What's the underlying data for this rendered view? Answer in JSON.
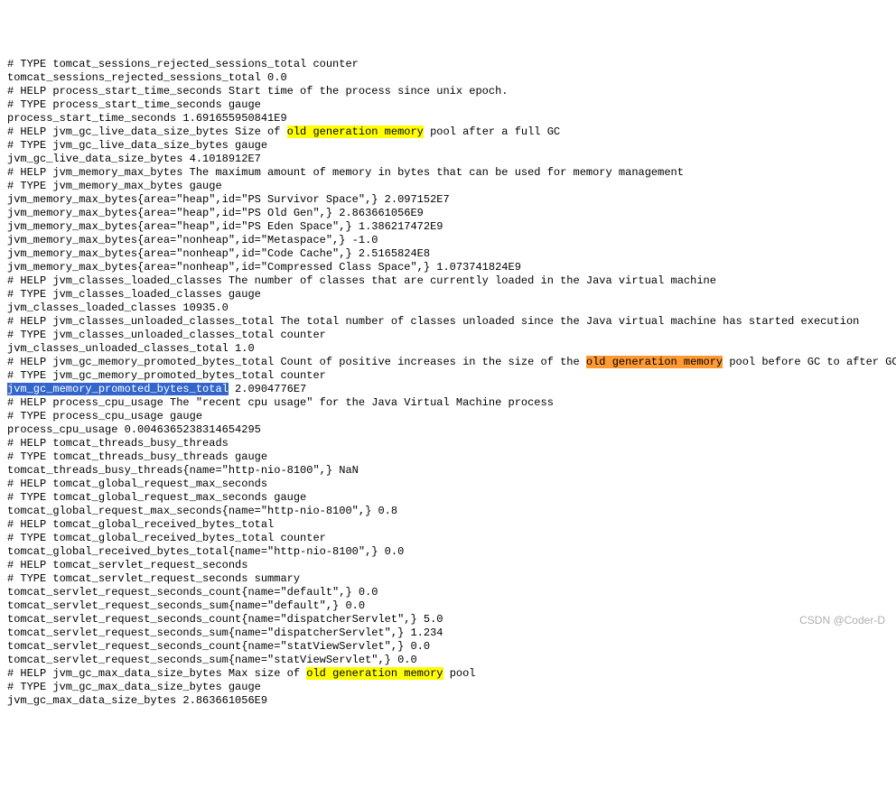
{
  "watermark": "CSDN @Coder-D",
  "lines": [
    {
      "parts": [
        {
          "t": "# TYPE tomcat_sessions_rejected_sessions_total counter"
        }
      ]
    },
    {
      "parts": [
        {
          "t": "tomcat_sessions_rejected_sessions_total 0.0"
        }
      ]
    },
    {
      "parts": [
        {
          "t": "# HELP process_start_time_seconds Start time of the process since unix epoch."
        }
      ]
    },
    {
      "parts": [
        {
          "t": "# TYPE process_start_time_seconds gauge"
        }
      ]
    },
    {
      "parts": [
        {
          "t": "process_start_time_seconds 1.691655950841E9"
        }
      ]
    },
    {
      "parts": [
        {
          "t": "# HELP jvm_gc_live_data_size_bytes Size of "
        },
        {
          "t": "old generation memory",
          "hl": "yellow"
        },
        {
          "t": " pool after a full GC"
        }
      ]
    },
    {
      "parts": [
        {
          "t": "# TYPE jvm_gc_live_data_size_bytes gauge"
        }
      ]
    },
    {
      "parts": [
        {
          "t": "jvm_gc_live_data_size_bytes 4.1018912E7"
        }
      ]
    },
    {
      "parts": [
        {
          "t": "# HELP jvm_memory_max_bytes The maximum amount of memory in bytes that can be used for memory management"
        }
      ]
    },
    {
      "parts": [
        {
          "t": "# TYPE jvm_memory_max_bytes gauge"
        }
      ]
    },
    {
      "parts": [
        {
          "t": "jvm_memory_max_bytes{area=\"heap\",id=\"PS Survivor Space\",} 2.097152E7"
        }
      ]
    },
    {
      "parts": [
        {
          "t": "jvm_memory_max_bytes{area=\"heap\",id=\"PS Old Gen\",} 2.863661056E9"
        }
      ]
    },
    {
      "parts": [
        {
          "t": "jvm_memory_max_bytes{area=\"heap\",id=\"PS Eden Space\",} 1.386217472E9"
        }
      ]
    },
    {
      "parts": [
        {
          "t": "jvm_memory_max_bytes{area=\"nonheap\",id=\"Metaspace\",} -1.0"
        }
      ]
    },
    {
      "parts": [
        {
          "t": "jvm_memory_max_bytes{area=\"nonheap\",id=\"Code Cache\",} 2.5165824E8"
        }
      ]
    },
    {
      "parts": [
        {
          "t": "jvm_memory_max_bytes{area=\"nonheap\",id=\"Compressed Class Space\",} 1.073741824E9"
        }
      ]
    },
    {
      "parts": [
        {
          "t": "# HELP jvm_classes_loaded_classes The number of classes that are currently loaded in the Java virtual machine"
        }
      ]
    },
    {
      "parts": [
        {
          "t": "# TYPE jvm_classes_loaded_classes gauge"
        }
      ]
    },
    {
      "parts": [
        {
          "t": "jvm_classes_loaded_classes 10935.0"
        }
      ]
    },
    {
      "parts": [
        {
          "t": "# HELP jvm_classes_unloaded_classes_total The total number of classes unloaded since the Java virtual machine has started execution"
        }
      ]
    },
    {
      "parts": [
        {
          "t": "# TYPE jvm_classes_unloaded_classes_total counter"
        }
      ]
    },
    {
      "parts": [
        {
          "t": "jvm_classes_unloaded_classes_total 1.0"
        }
      ]
    },
    {
      "parts": [
        {
          "t": "# HELP jvm_gc_memory_promoted_bytes_total Count of positive increases in the size of the "
        },
        {
          "t": "old generation memory",
          "hl": "orange"
        },
        {
          "t": " pool before GC to after GC"
        }
      ]
    },
    {
      "parts": [
        {
          "t": "# TYPE jvm_gc_memory_promoted_bytes_total counter"
        }
      ]
    },
    {
      "parts": [
        {
          "t": "jvm_gc_memory_promoted_bytes_total",
          "hl": "blue"
        },
        {
          "t": " 2.0904776E7"
        }
      ]
    },
    {
      "parts": [
        {
          "t": "# HELP process_cpu_usage The \"recent cpu usage\" for the Java Virtual Machine process"
        }
      ]
    },
    {
      "parts": [
        {
          "t": "# TYPE process_cpu_usage gauge"
        }
      ]
    },
    {
      "parts": [
        {
          "t": "process_cpu_usage 0.0046365238314654295"
        }
      ]
    },
    {
      "parts": [
        {
          "t": "# HELP tomcat_threads_busy_threads"
        }
      ]
    },
    {
      "parts": [
        {
          "t": "# TYPE tomcat_threads_busy_threads gauge"
        }
      ]
    },
    {
      "parts": [
        {
          "t": "tomcat_threads_busy_threads{name=\"http-nio-8100\",} NaN"
        }
      ]
    },
    {
      "parts": [
        {
          "t": "# HELP tomcat_global_request_max_seconds"
        }
      ]
    },
    {
      "parts": [
        {
          "t": "# TYPE tomcat_global_request_max_seconds gauge"
        }
      ]
    },
    {
      "parts": [
        {
          "t": "tomcat_global_request_max_seconds{name=\"http-nio-8100\",} 0.8"
        }
      ]
    },
    {
      "parts": [
        {
          "t": "# HELP tomcat_global_received_bytes_total"
        }
      ]
    },
    {
      "parts": [
        {
          "t": "# TYPE tomcat_global_received_bytes_total counter"
        }
      ]
    },
    {
      "parts": [
        {
          "t": "tomcat_global_received_bytes_total{name=\"http-nio-8100\",} 0.0"
        }
      ]
    },
    {
      "parts": [
        {
          "t": "# HELP tomcat_servlet_request_seconds"
        }
      ]
    },
    {
      "parts": [
        {
          "t": "# TYPE tomcat_servlet_request_seconds summary"
        }
      ]
    },
    {
      "parts": [
        {
          "t": "tomcat_servlet_request_seconds_count{name=\"default\",} 0.0"
        }
      ]
    },
    {
      "parts": [
        {
          "t": "tomcat_servlet_request_seconds_sum{name=\"default\",} 0.0"
        }
      ]
    },
    {
      "parts": [
        {
          "t": "tomcat_servlet_request_seconds_count{name=\"dispatcherServlet\",} 5.0"
        }
      ]
    },
    {
      "parts": [
        {
          "t": "tomcat_servlet_request_seconds_sum{name=\"dispatcherServlet\",} 1.234"
        }
      ]
    },
    {
      "parts": [
        {
          "t": "tomcat_servlet_request_seconds_count{name=\"statViewServlet\",} 0.0"
        }
      ]
    },
    {
      "parts": [
        {
          "t": "tomcat_servlet_request_seconds_sum{name=\"statViewServlet\",} 0.0"
        }
      ]
    },
    {
      "parts": [
        {
          "t": "# HELP jvm_gc_max_data_size_bytes Max size of "
        },
        {
          "t": "old generation memory",
          "hl": "yellow"
        },
        {
          "t": " pool"
        }
      ]
    },
    {
      "parts": [
        {
          "t": "# TYPE jvm_gc_max_data_size_bytes gauge"
        }
      ]
    },
    {
      "parts": [
        {
          "t": "jvm_gc_max_data_size_bytes 2.863661056E9"
        }
      ]
    }
  ]
}
